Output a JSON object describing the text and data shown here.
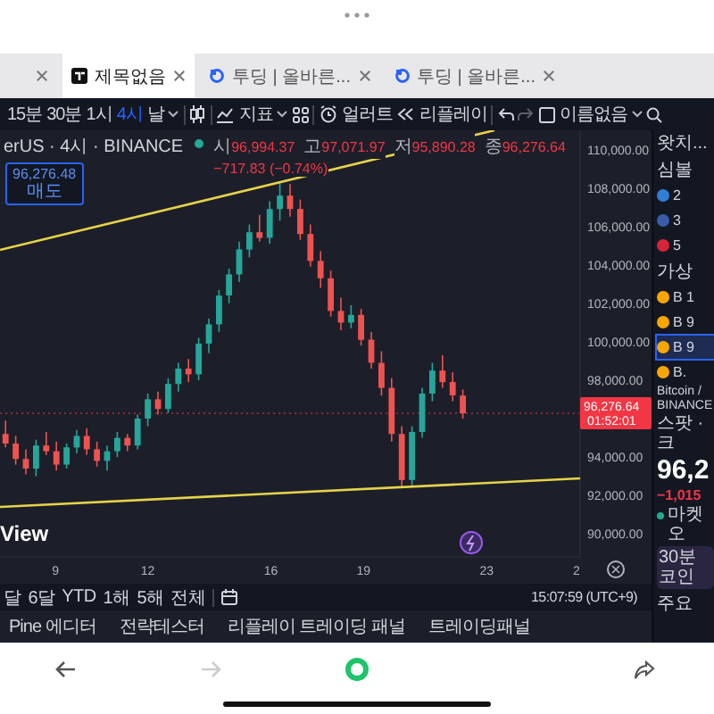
{
  "browser_tabs": [
    {
      "kind": "partial",
      "selected": false
    },
    {
      "kind": "chart",
      "title": "제목없음",
      "selected": true
    },
    {
      "kind": "site",
      "title": "투딩 | 올바른...",
      "selected": false
    },
    {
      "kind": "site",
      "title": "투딩 | 올바른...",
      "selected": false
    }
  ],
  "toolbar": {
    "intervals": [
      {
        "label": "15분",
        "selected": false
      },
      {
        "label": "30분",
        "selected": false
      },
      {
        "label": "1시",
        "selected": false
      },
      {
        "label": "4시",
        "selected": true
      },
      {
        "label": "날",
        "selected": false
      }
    ],
    "indicators": "지표",
    "alert": "얼러트",
    "replay": "리플레이",
    "layout": "이름없음"
  },
  "chart": {
    "symbol": "erUS · 4시 · BINANCE",
    "ohlc": [
      {
        "label": "시",
        "value": "96,994.37"
      },
      {
        "label": "고",
        "value": "97,071.97"
      },
      {
        "label": "저",
        "value": "95,890.28"
      },
      {
        "label": "종",
        "value": "96,276.64"
      }
    ],
    "change": "−717.83 (−0.74%)",
    "sell_box": {
      "price": "96,276.48",
      "label": "매도"
    },
    "chart_data": {
      "type": "candlestick",
      "x": [
        7.38,
        7.71,
        8.04,
        8.37,
        8.7,
        9.03,
        9.36,
        9.69,
        10.02,
        10.35,
        10.68,
        11.01,
        11.34,
        11.67,
        12.0,
        12.33,
        12.66,
        12.99,
        13.32,
        13.65,
        13.98,
        14.31,
        14.64,
        14.97,
        15.3,
        15.63,
        15.96,
        16.29,
        16.62,
        16.95,
        17.28,
        17.61,
        17.94,
        18.27,
        18.6,
        18.93,
        19.26,
        19.59,
        19.92,
        20.25,
        20.58,
        20.91,
        21.24,
        21.57,
        21.9,
        22.23
      ],
      "xticks": [
        {
          "value": 9,
          "label": "9"
        },
        {
          "value": 12,
          "label": "12"
        },
        {
          "value": 16,
          "label": "16"
        },
        {
          "value": 19,
          "label": "19"
        },
        {
          "value": 23,
          "label": "23"
        }
      ],
      "xlim": [
        7.2,
        26.04
      ],
      "ylim": [
        88800,
        111000
      ],
      "ref_lines": [
        {
          "axis": "y",
          "value": 96276.64,
          "label": "96,276.64"
        }
      ],
      "ohlc": [
        [
          95200,
          95900,
          94500,
          94700
        ],
        [
          94700,
          95100,
          93600,
          93900
        ],
        [
          93900,
          94400,
          93100,
          93400
        ],
        [
          93400,
          94900,
          93000,
          94600
        ],
        [
          94600,
          95300,
          94100,
          94300
        ],
        [
          94300,
          94800,
          93300,
          93600
        ],
        [
          93600,
          94700,
          93400,
          94500
        ],
        [
          94500,
          95400,
          94200,
          95100
        ],
        [
          95100,
          95500,
          94100,
          94400
        ],
        [
          94400,
          94800,
          93500,
          93800
        ],
        [
          93800,
          94600,
          93300,
          94300
        ],
        [
          94300,
          95300,
          94000,
          95000
        ],
        [
          95000,
          95200,
          94300,
          94600
        ],
        [
          94600,
          96200,
          94400,
          96000
        ],
        [
          96000,
          97300,
          95600,
          97000
        ],
        [
          97000,
          97400,
          96200,
          96500
        ],
        [
          96500,
          98100,
          96300,
          97800
        ],
        [
          97800,
          98900,
          97400,
          98600
        ],
        [
          98600,
          99100,
          97900,
          98300
        ],
        [
          98300,
          100200,
          98000,
          99900
        ],
        [
          99900,
          101200,
          99400,
          100900
        ],
        [
          100900,
          102700,
          100500,
          102400
        ],
        [
          102400,
          103800,
          102000,
          103500
        ],
        [
          103500,
          105200,
          103100,
          104800
        ],
        [
          104800,
          106100,
          104400,
          105700
        ],
        [
          105700,
          106600,
          105200,
          105400
        ],
        [
          105400,
          107300,
          105100,
          106900
        ],
        [
          106900,
          108300,
          106300,
          107600
        ],
        [
          107600,
          108200,
          106500,
          106900
        ],
        [
          106900,
          107400,
          105300,
          105600
        ],
        [
          105600,
          106100,
          103900,
          104200
        ],
        [
          104200,
          104700,
          102800,
          103300
        ],
        [
          103300,
          103700,
          101300,
          101600
        ],
        [
          101600,
          102300,
          100600,
          101000
        ],
        [
          101000,
          101900,
          100700,
          101400
        ],
        [
          101400,
          101700,
          99800,
          100100
        ],
        [
          100100,
          100500,
          98600,
          98900
        ],
        [
          98900,
          99500,
          97200,
          97600
        ],
        [
          97600,
          98100,
          94800,
          95200
        ],
        [
          95200,
          95600,
          92400,
          92800
        ],
        [
          92800,
          95600,
          92500,
          95300
        ],
        [
          95300,
          97600,
          95000,
          97300
        ],
        [
          97300,
          98900,
          96900,
          98500
        ],
        [
          98500,
          99300,
          97600,
          97900
        ],
        [
          97900,
          98400,
          96900,
          97200
        ],
        [
          97200,
          97500,
          96000,
          96276.64
        ]
      ],
      "yticks": [
        {
          "value": 110000,
          "label": "110,000.00"
        },
        {
          "value": 108000,
          "label": "108,000.00"
        },
        {
          "value": 106000,
          "label": "106,000.00"
        },
        {
          "value": 104000,
          "label": "104,000.00"
        },
        {
          "value": 102000,
          "label": "102,000.00"
        },
        {
          "value": 100000,
          "label": "100,000.00"
        },
        {
          "value": 98000,
          "label": "98,000.00"
        },
        {
          "value": 94000,
          "label": "94,000.00"
        },
        {
          "value": 92000,
          "label": "92,000.00"
        },
        {
          "value": 90000,
          "label": "90,000.00"
        }
      ]
    },
    "countdown": "01:52:01",
    "month_tick": "2",
    "logo_text": "View"
  },
  "range_bar": {
    "ranges": [
      "달",
      "6달",
      "YTD",
      "1해",
      "5해",
      "전체"
    ],
    "clock": "15:07:59 (UTC+9)"
  },
  "bottom_tabs": [
    "Pine 에디터",
    "전략테스터",
    "리플레이 트레이딩 패널",
    "트레이딩패널"
  ],
  "watchlist": {
    "title": "왓치...",
    "column": "심볼",
    "indices": [
      {
        "text": "2",
        "color": "#2f7fd8"
      },
      {
        "text": "3",
        "color": "#3a5ba8"
      },
      {
        "text": "5",
        "color": "#d6243a"
      }
    ],
    "group": "가상",
    "coins": [
      {
        "text": "B 1",
        "selected": false
      },
      {
        "text": "B 9",
        "selected": false
      },
      {
        "text": "B 9",
        "selected": true
      }
    ],
    "detail": {
      "ticker": "B.",
      "name": "Bitcoin /",
      "exchange": "BINANCE",
      "type": "스팟 · 크",
      "price": "96,2",
      "change": "−1,015",
      "status": "마켓 오",
      "promo": "30분 코인",
      "section": "주요"
    }
  }
}
